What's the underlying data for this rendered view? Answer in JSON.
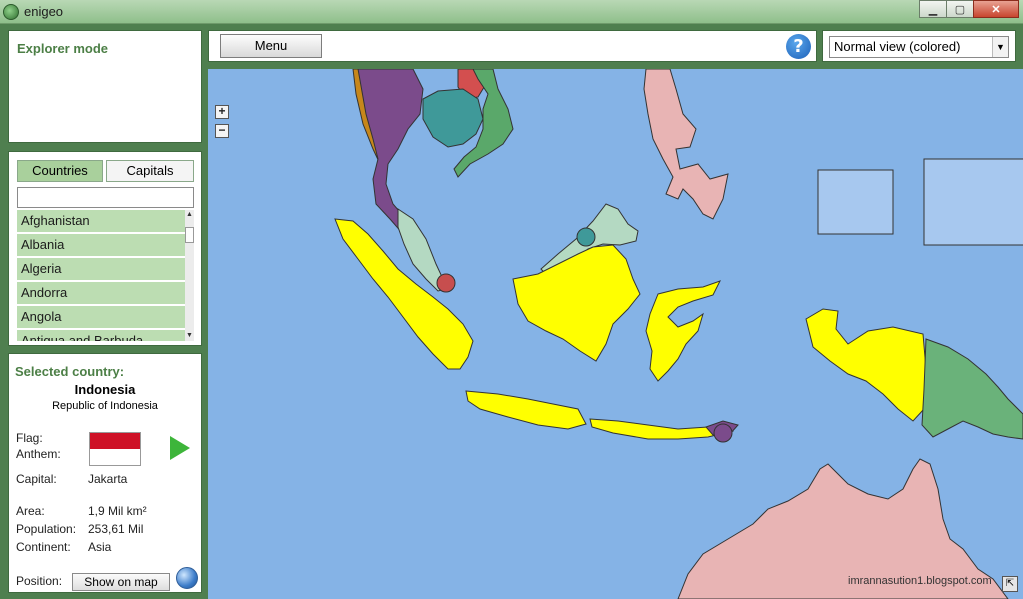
{
  "window": {
    "title": "enigeo",
    "minimize": "▁",
    "maximize": "▢",
    "close": "✕"
  },
  "explorer": {
    "title": "Explorer mode"
  },
  "tabs": {
    "countries": "Countries",
    "capitals": "Capitals"
  },
  "search": {
    "value": ""
  },
  "countries": [
    "Afghanistan",
    "Albania",
    "Algeria",
    "Andorra",
    "Angola",
    "Antigua and Barbuda"
  ],
  "selected": {
    "heading": "Selected country:",
    "name": "Indonesia",
    "official_name": "Republic of Indonesia",
    "flag_label": "Flag:",
    "anthem_label": "Anthem:",
    "capital_label": "Capital:",
    "capital": "Jakarta",
    "area_label": "Area:",
    "area": "1,9 Mil km²",
    "population_label": "Population:",
    "population": "253,61 Mil",
    "continent_label": "Continent:",
    "continent": "Asia",
    "position_label": "Position:",
    "show_on_map": "Show on map",
    "flag_colors": [
      "#ce1126",
      "#ffffff"
    ]
  },
  "toolbar": {
    "menu_label": "Menu",
    "help_icon": "?"
  },
  "view": {
    "selected": "Normal view (colored)"
  },
  "map": {
    "zoom_in": "+",
    "zoom_out": "−",
    "watermark": "imrannasution1.blogspot.com",
    "corner_icon": "⇱",
    "colors": {
      "ocean": "#85b3e6",
      "indonesia": "#ffff00",
      "malaysia": "#b4d9c2",
      "australia": "#e8b4b4",
      "png": "#6ab27a",
      "thailand": "#7b4b8b",
      "cambodia": "#3f9999",
      "vietnam": "#5aa86a"
    }
  }
}
